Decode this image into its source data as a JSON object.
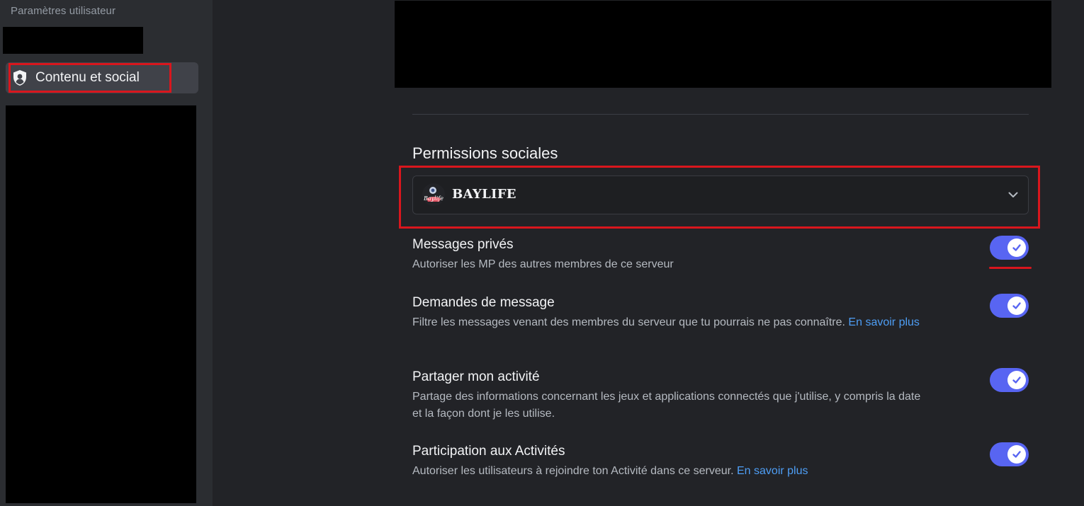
{
  "sidebar": {
    "header": "Paramètres utilisateur",
    "active_item": {
      "label": "Contenu et social",
      "icon": "shield-user-icon"
    }
  },
  "main": {
    "section_title": "Permissions sociales",
    "server_selector": {
      "name": "BAYLIFE",
      "icon": "chevron-down-icon"
    },
    "settings": [
      {
        "title": "Messages privés",
        "description": "Autoriser les MP des autres membres de ce serveur",
        "link": "",
        "enabled": true
      },
      {
        "title": "Demandes de message",
        "description": "Filtre les messages venant des membres du serveur que tu pourrais ne pas connaître. ",
        "link": "En savoir plus",
        "enabled": true
      },
      {
        "title": "Partager mon activité",
        "description": "Partage des informations concernant les jeux et applications connectés que j'utilise, y compris la date et la façon dont je les utilise.",
        "link": "",
        "enabled": true
      },
      {
        "title": "Participation aux Activités",
        "description": "Autoriser les utilisateurs à rejoindre ton Activité dans ce serveur. ",
        "link": "En savoir plus",
        "enabled": true
      }
    ]
  },
  "colors": {
    "accent": "#5865f2",
    "highlight_red": "#d9161d",
    "link": "#4e9ef5"
  }
}
